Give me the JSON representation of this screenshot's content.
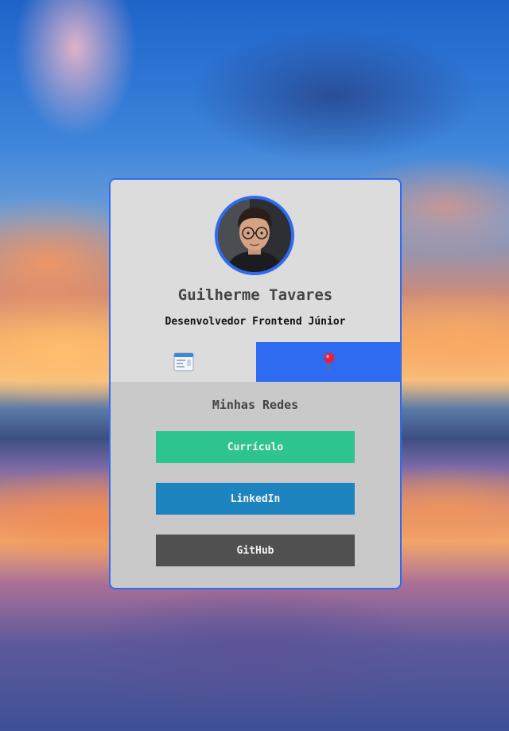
{
  "profile": {
    "name": "Guilherme Tavares",
    "role": "Desenvolvedor Frontend Júnior",
    "avatar_icon": "profile-photo"
  },
  "tabs": [
    {
      "icon": "browser-window-icon",
      "active": false
    },
    {
      "icon": "map-pin-icon",
      "active": true
    }
  ],
  "networks": {
    "title": "Minhas Redes",
    "buttons": [
      {
        "label": "Currículo",
        "color": "#2ec48f"
      },
      {
        "label": "LinkedIn",
        "color": "#1e84c0"
      },
      {
        "label": "GitHub",
        "color": "#505050"
      }
    ]
  },
  "colors": {
    "accent": "#2f6bf0",
    "card_top": "#dcdcdc",
    "card_bottom": "#c9c9c9"
  }
}
